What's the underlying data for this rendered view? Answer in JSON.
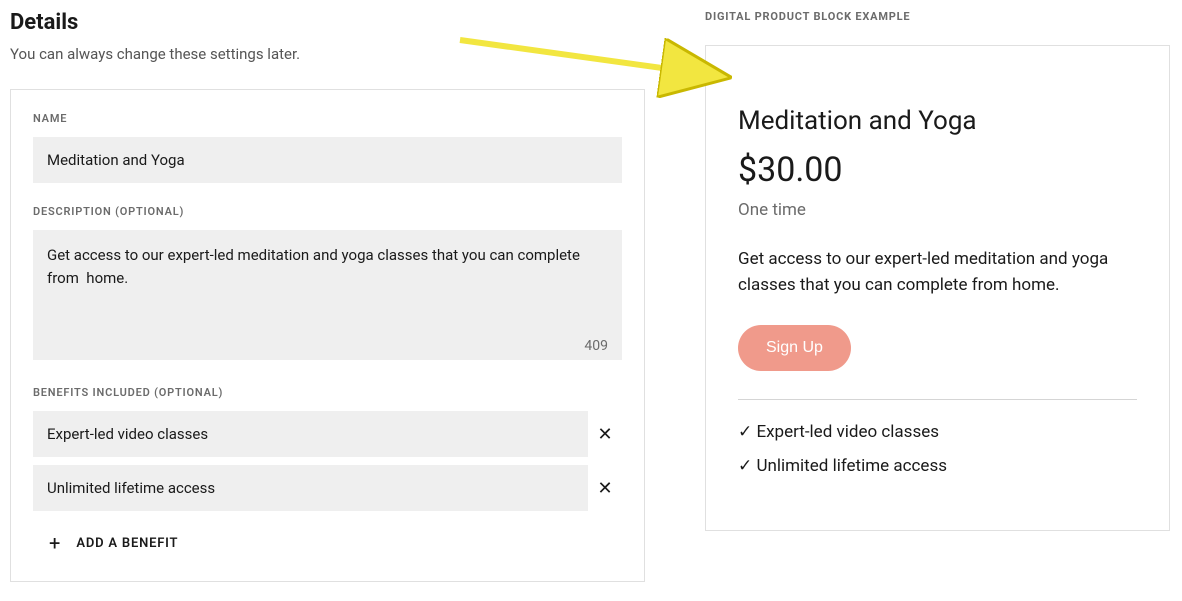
{
  "page": {
    "title": "Details",
    "subtitle": "You can always change these settings later."
  },
  "form": {
    "name_label": "NAME",
    "name_value": "Meditation and Yoga",
    "description_label": "DESCRIPTION (OPTIONAL)",
    "description_value": "Get access to our expert-led meditation and yoga classes that you can complete from  home.",
    "char_count": "409",
    "benefits_label": "BENEFITS INCLUDED (OPTIONAL)",
    "benefits": [
      {
        "text": "Expert-led video classes"
      },
      {
        "text": "Unlimited lifetime access"
      }
    ],
    "add_benefit_label": "ADD A BENEFIT"
  },
  "preview": {
    "header": "DIGITAL PRODUCT BLOCK EXAMPLE",
    "title": "Meditation and Yoga",
    "price": "$30.00",
    "frequency": "One time",
    "description": "Get access to our expert-led meditation and yoga classes that you can complete from home.",
    "signup_label": "Sign Up",
    "benefits": [
      "✓ Expert-led video classes",
      "✓ Unlimited lifetime access"
    ]
  }
}
